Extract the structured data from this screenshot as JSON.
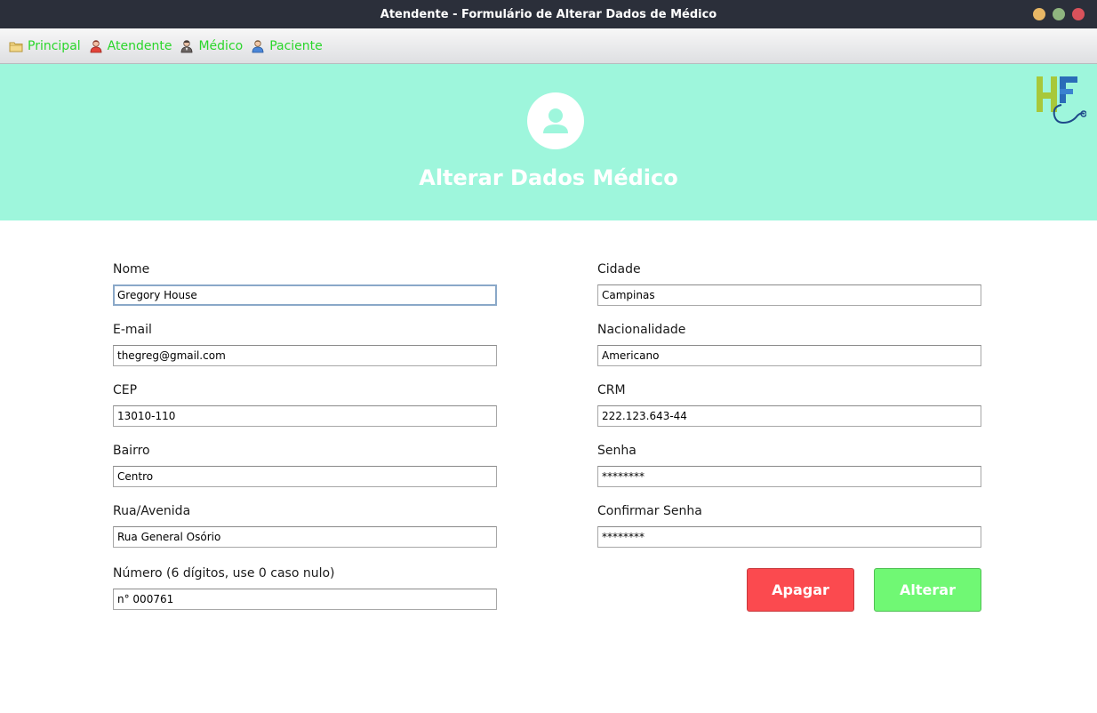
{
  "window": {
    "title": "Atendente - Formulário de Alterar Dados de Médico",
    "buttons": [
      {
        "name": "minimize",
        "color": "#e8b765"
      },
      {
        "name": "maximize",
        "color": "#8fb57f"
      },
      {
        "name": "close",
        "color": "#d9525b"
      }
    ]
  },
  "menu": {
    "items": [
      {
        "label": "Principal",
        "icon": "folder-icon"
      },
      {
        "label": "Atendente",
        "icon": "user-red-icon"
      },
      {
        "label": "Médico",
        "icon": "user-doctor-icon"
      },
      {
        "label": "Paciente",
        "icon": "user-blue-icon"
      }
    ]
  },
  "header": {
    "title": "Alterar Dados Médico",
    "avatar_icon": "user-icon",
    "logo_icon": "hf-logo-icon",
    "background": "#9ef6dc"
  },
  "form": {
    "left": [
      {
        "label": "Nome",
        "value": "Gregory House"
      },
      {
        "label": "E-mail",
        "value": "thegreg@gmail.com"
      },
      {
        "label": "CEP",
        "value": "13010-110"
      },
      {
        "label": "Bairro",
        "value": "Centro"
      },
      {
        "label": "Rua/Avenida",
        "value": "Rua General Osório"
      },
      {
        "label": "Número (6 dígitos, use 0 caso nulo)",
        "value": "n° 000761"
      }
    ],
    "right": [
      {
        "label": "Cidade",
        "value": "Campinas"
      },
      {
        "label": "Nacionalidade",
        "value": "Americano"
      },
      {
        "label": "CRM",
        "value": "222.123.643-44"
      },
      {
        "label": "Senha",
        "value": "********"
      },
      {
        "label": "Confirmar Senha",
        "value": "********"
      }
    ]
  },
  "actions": {
    "delete_label": "Apagar",
    "delete_color": "#fb4a4f",
    "update_label": "Alterar",
    "update_color": "#70f874"
  }
}
